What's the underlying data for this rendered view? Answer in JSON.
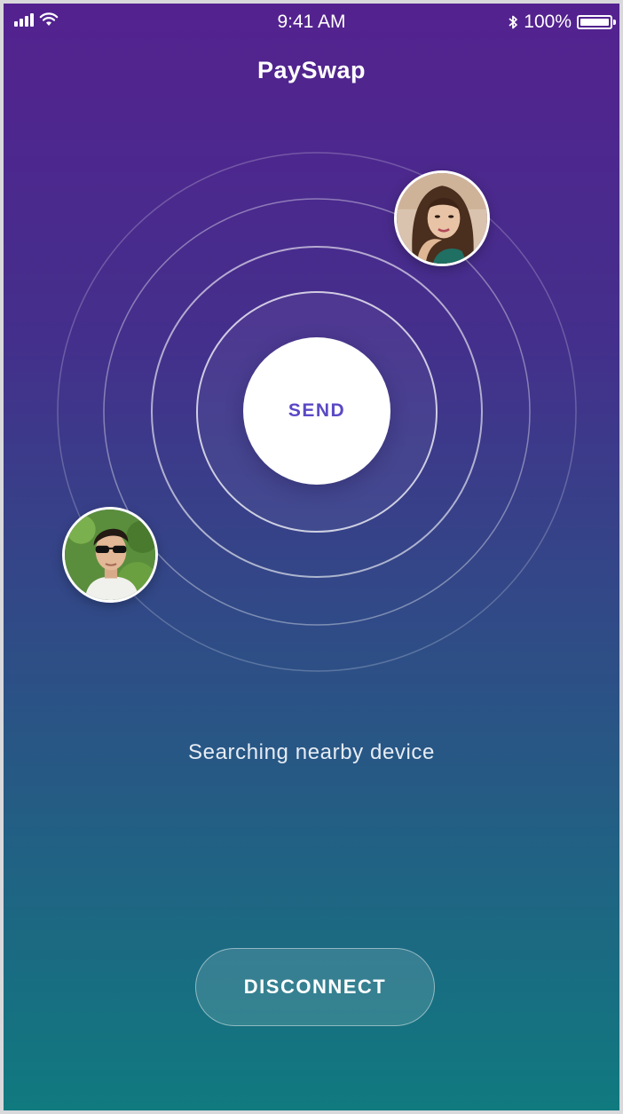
{
  "status_bar": {
    "time": "9:41 AM",
    "battery": "100%",
    "wifi_icon": "wifi-icon",
    "bluetooth_icon": "bluetooth-icon"
  },
  "app": {
    "title": "PaySwap"
  },
  "radar": {
    "send_label": "SEND",
    "avatars": [
      "woman-avatar",
      "man-avatar"
    ]
  },
  "status": {
    "text": "Searching nearby device"
  },
  "actions": {
    "disconnect_label": "DISCONNECT"
  },
  "colors": {
    "gradient_top": "#54228f",
    "gradient_bottom": "#107a7f",
    "accent": "#5a49c6"
  }
}
